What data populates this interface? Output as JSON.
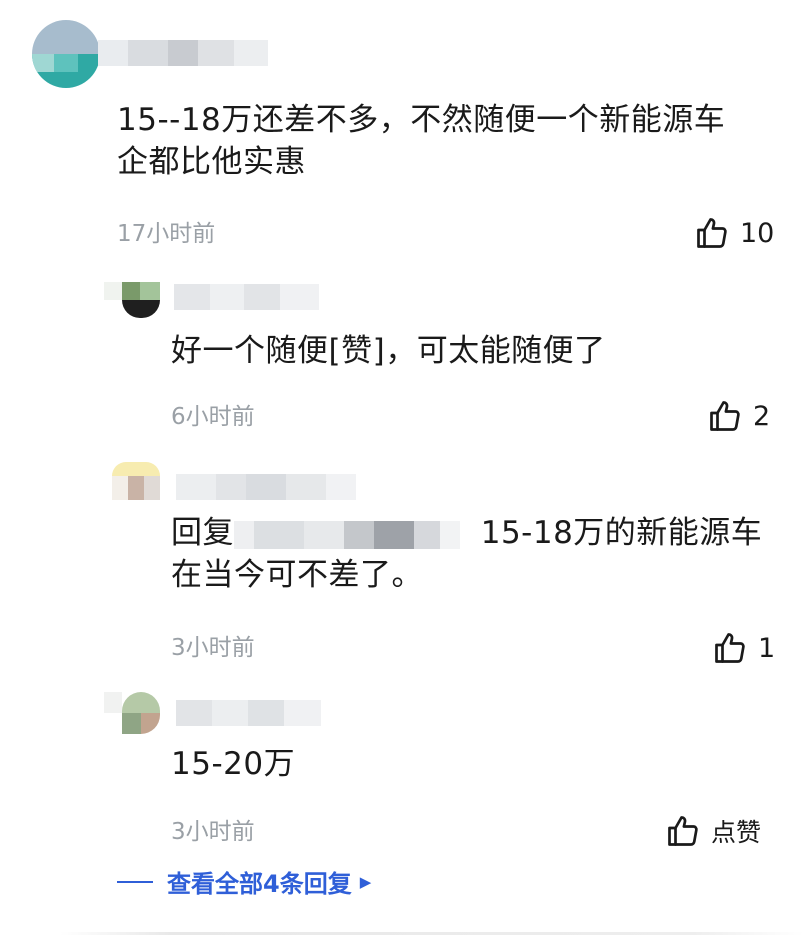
{
  "comments": [
    {
      "text_line1": "15--18万还差不多，不然随便一个新能源车",
      "text_line2": "企都比他实惠",
      "time": "17小时前",
      "likes": "10"
    }
  ],
  "replies": [
    {
      "text": "好一个随便[赞]，可太能随便了",
      "time": "6小时前",
      "likes": "2"
    },
    {
      "prefix": "回复",
      "suffix": "15-18万的新能源车",
      "text_line2": "在当今可不差了。",
      "time": "3小时前",
      "likes": "1"
    },
    {
      "text": "15-20万",
      "time": "3小时前",
      "likes": "点赞"
    }
  ],
  "view_all": {
    "label": "查看全部4条回复",
    "arrow": "▶"
  },
  "colors": {
    "link": "#2f5fd8",
    "time": "#9aa0a6",
    "text": "#1a1a1a"
  },
  "icons": [
    "thumbs-up-icon",
    "play-arrow-icon"
  ]
}
